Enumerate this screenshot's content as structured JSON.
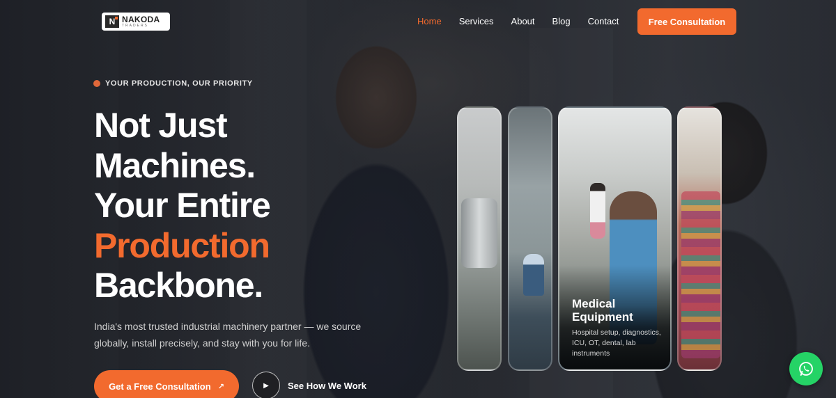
{
  "brand": {
    "logo_mark": "N",
    "name": "NAKODA",
    "sub": "TRADERS"
  },
  "nav": {
    "items": [
      {
        "label": "Home",
        "active": true
      },
      {
        "label": "Services",
        "active": false
      },
      {
        "label": "About",
        "active": false
      },
      {
        "label": "Blog",
        "active": false
      },
      {
        "label": "Contact",
        "active": false
      }
    ],
    "cta_label": "Free Consultation"
  },
  "hero": {
    "eyebrow": "YOUR PRODUCTION, OUR PRIORITY",
    "headline": {
      "line1": "Not Just",
      "line2": "Machines.",
      "line3": "Your Entire",
      "line4_accent": "Production",
      "line5": "Backbone."
    },
    "description": "India's most trusted industrial machinery partner — we source globally, install precisely, and stay with you for life.",
    "primary_button": "Get a Free Consultation",
    "primary_button_icon": "↗",
    "video_button": "See How We Work",
    "play_icon": "▶"
  },
  "panels": {
    "featured": {
      "title": "Medical Equipment",
      "text": "Hospital setup, diagnostics, ICU, OT, dental, lab instruments"
    }
  },
  "colors": {
    "accent": "#f26a2e",
    "whatsapp": "#25d366"
  },
  "icons": {
    "whatsapp": "whatsapp-icon",
    "play": "play-icon",
    "arrow": "arrow-up-right-icon"
  }
}
